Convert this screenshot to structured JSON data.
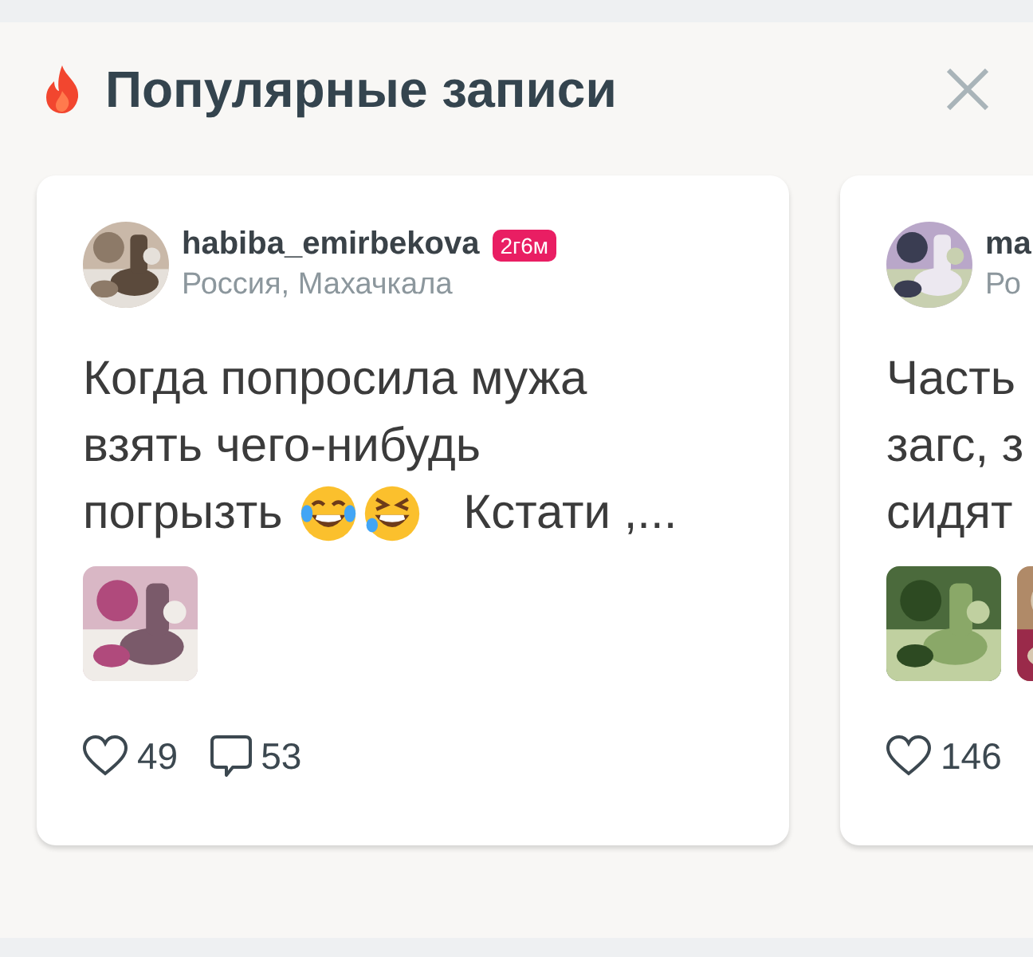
{
  "section": {
    "title": "Популярные записи"
  },
  "posts": [
    {
      "author": "habiba_emirbekova",
      "badge": "2г6м",
      "location": "Россия, Махачкала",
      "text_lines": [
        [
          {
            "kind": "text",
            "text": "Когда попросила мужа"
          }
        ],
        [
          {
            "kind": "text",
            "text": "взять чего-нибудь"
          }
        ],
        [
          {
            "kind": "text",
            "text": "погрызть "
          },
          {
            "kind": "tears-emoji"
          },
          {
            "kind": "squint-emoji"
          },
          {
            "kind": "text",
            "text": "   Кстати ,..."
          }
        ]
      ],
      "photos": [
        {
          "kind": "picture"
        }
      ],
      "likes": "49",
      "comments": "53"
    },
    {
      "author": "ma",
      "location": "Ро",
      "text_lines": [
        [
          {
            "kind": "text",
            "text": "Часть"
          }
        ],
        [
          {
            "kind": "text",
            "text": "загс, з"
          }
        ],
        [
          {
            "kind": "text",
            "text": "сидят"
          }
        ]
      ],
      "photos": [
        {
          "kind": "picture"
        },
        {
          "kind": "picture"
        }
      ],
      "likes": "146"
    }
  ]
}
